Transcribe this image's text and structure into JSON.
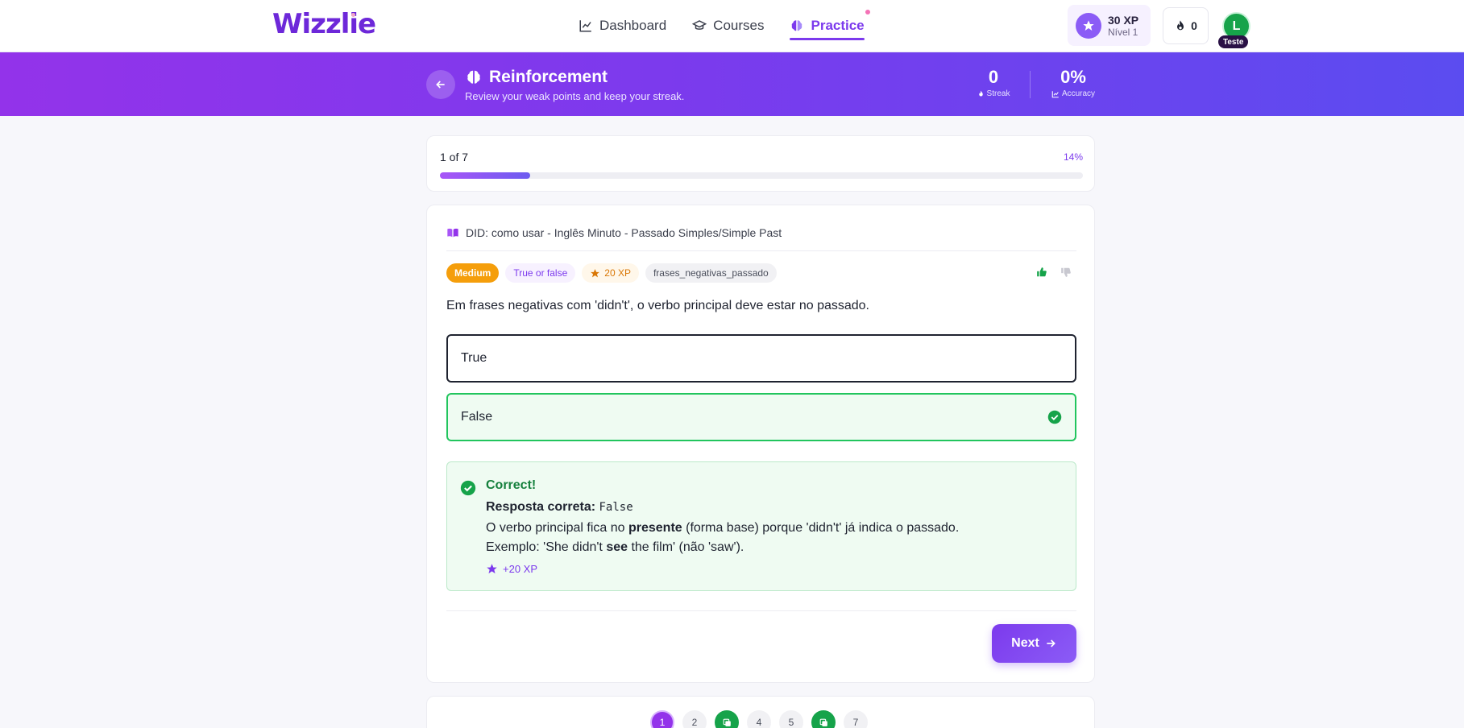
{
  "header": {
    "logo": "Wizzlie",
    "nav": [
      {
        "label": "Dashboard",
        "icon": "chart-line-icon",
        "active": false
      },
      {
        "label": "Courses",
        "icon": "graduation-cap-icon",
        "active": false
      },
      {
        "label": "Practice",
        "icon": "brain-icon",
        "active": true
      }
    ],
    "xp": {
      "value": "30 XP",
      "level": "Nível 1"
    },
    "streak": "0",
    "avatar": {
      "initial": "L",
      "name": "Teste"
    }
  },
  "banner": {
    "title": "Reinforcement",
    "subtitle": "Review your weak points and keep your streak.",
    "stats": [
      {
        "value": "0",
        "label": "Streak",
        "icon": "flame-icon"
      },
      {
        "value": "0%",
        "label": "Accuracy",
        "icon": "chart-icon"
      }
    ]
  },
  "progress": {
    "label": "1 of 7",
    "percent_label": "14%",
    "fraction": 0.14
  },
  "question": {
    "source": "DID: como usar - Inglês Minuto - Passado Simples/Simple Past",
    "tags": {
      "difficulty": "Medium",
      "type": "True or false",
      "xp": "20 XP",
      "topic": "frases_negativas_passado"
    },
    "text": "Em frases negativas com 'didn't', o verbo principal deve estar no passado.",
    "options": [
      {
        "label": "True",
        "state": "selected"
      },
      {
        "label": "False",
        "state": "correct"
      }
    ]
  },
  "feedback": {
    "title": "Correct!",
    "answer_label": "Resposta correta:",
    "answer_value": "False",
    "explanation": {
      "line1_a": "O verbo principal fica no ",
      "line1_b": "presente",
      "line1_c": " (forma base) porque 'didn't' já indica o passado.",
      "line2_a": "Exemplo: 'She didn't ",
      "line2_b": "see",
      "line2_c": " the film' (não 'saw')."
    },
    "xp_gain": "+20 XP"
  },
  "actions": {
    "next_label": "Next"
  },
  "pagination": [
    {
      "label": "1",
      "state": "current"
    },
    {
      "label": "2",
      "state": "pending"
    },
    {
      "label": "",
      "state": "done"
    },
    {
      "label": "4",
      "state": "pending"
    },
    {
      "label": "5",
      "state": "pending"
    },
    {
      "label": "",
      "state": "done"
    },
    {
      "label": "7",
      "state": "pending"
    }
  ],
  "colors": {
    "accent": "#7c3aed",
    "success": "#22c55e",
    "warning": "#f59e0b"
  }
}
